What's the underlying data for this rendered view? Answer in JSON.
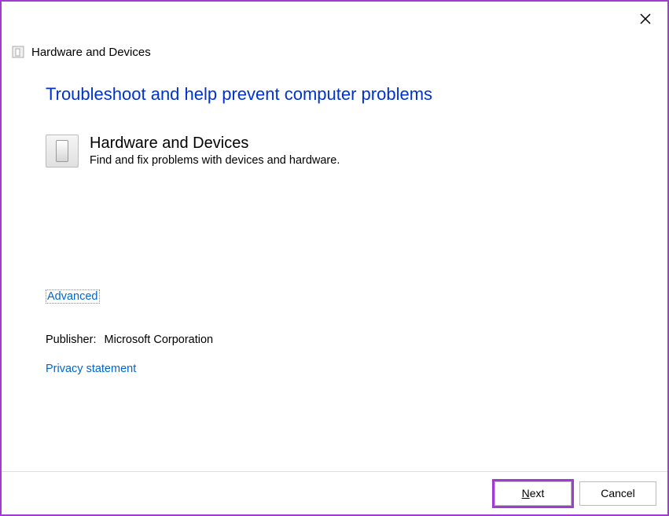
{
  "window": {
    "title": "Hardware and Devices"
  },
  "main": {
    "heading": "Troubleshoot and help prevent computer problems",
    "troubleshooter": {
      "title": "Hardware and Devices",
      "description": "Find and fix problems with devices and hardware."
    },
    "advanced_label": "Advanced",
    "publisher_label": "Publisher:",
    "publisher_value": "Microsoft Corporation",
    "privacy_label": "Privacy statement"
  },
  "footer": {
    "next_prefix": "N",
    "next_suffix": "ext",
    "cancel_label": "Cancel"
  }
}
